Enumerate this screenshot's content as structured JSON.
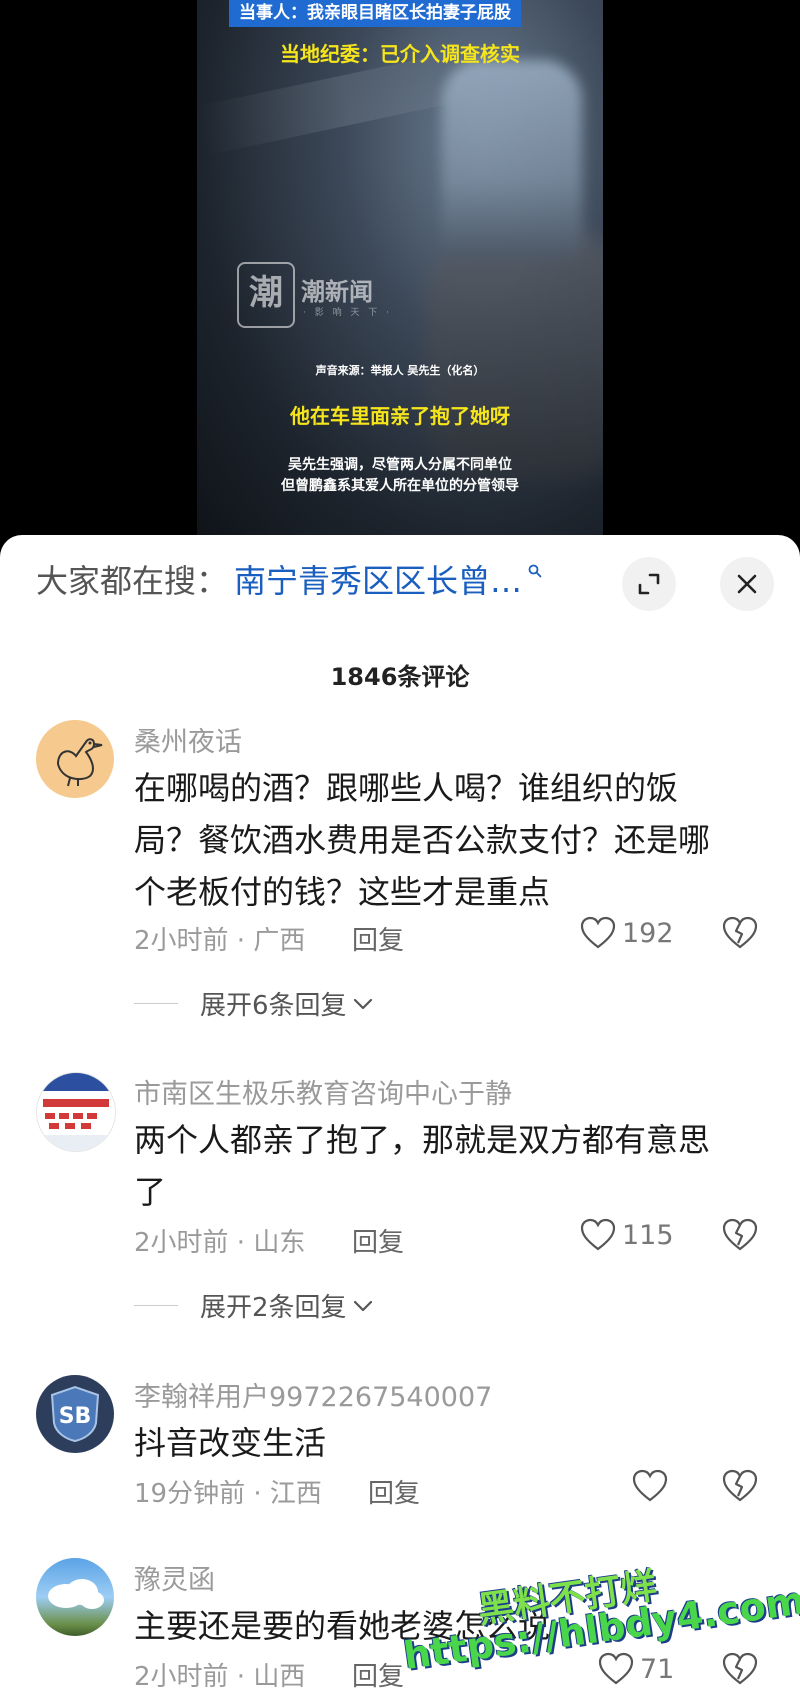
{
  "video": {
    "caption_top": "当事人：我亲眼目睹区长拍妻子屁股",
    "caption_sub": "当地纪委：已介入调查核实",
    "logo_glyph": "潮",
    "logo_name": "潮新闻",
    "logo_tag": "· 影 响 天 下 ·",
    "source": "声音来源：举报人 吴先生（化名）",
    "quote": "他在车里面亲了抱了她呀",
    "note_line1": "吴先生强调，尽管两人分属不同单位",
    "note_line2": "但曾鹏鑫系其爱人所在单位的分管领导"
  },
  "search": {
    "label": "大家都在搜：",
    "term": "南宁青秀区区长曾…"
  },
  "comments_header": "1846条评论",
  "comments": [
    {
      "user": "桑州夜话",
      "lines": [
        "在哪喝的酒？跟哪些人喝？谁组织的饭",
        "局？餐饮酒水费用是否公款支付？还是哪",
        "个老板付的钱？这些才是重点"
      ],
      "meta": "2小时前 · 广西",
      "reply": "回复",
      "likes": "192",
      "expand": "展开6条回复"
    },
    {
      "user": "市南区生极乐教育咨询中心于静",
      "lines": [
        "两个人都亲了抱了，那就是双方都有意思",
        "了"
      ],
      "meta": "2小时前 · 山东",
      "reply": "回复",
      "likes": "115",
      "expand": "展开2条回复"
    },
    {
      "user": "李翰祥用户9972267540007",
      "lines": [
        "抖音改变生活"
      ],
      "meta": "19分钟前 · 江西",
      "reply": "回复",
      "likes": ""
    },
    {
      "user": "豫灵函",
      "lines": [
        "主要还是要的看她老婆怎么说"
      ],
      "meta": "2小时前 · 山西",
      "reply": "回复",
      "likes": "71"
    }
  ],
  "watermark": {
    "line1": "黑料不打烊",
    "line2": "https://hlbdy4.com"
  },
  "colors": {
    "accent_blue": "#1a5fbf",
    "caption_yellow": "#f6e51b",
    "caption_bar": "#1f6bd1",
    "watermark_green": "#4ad64a"
  }
}
